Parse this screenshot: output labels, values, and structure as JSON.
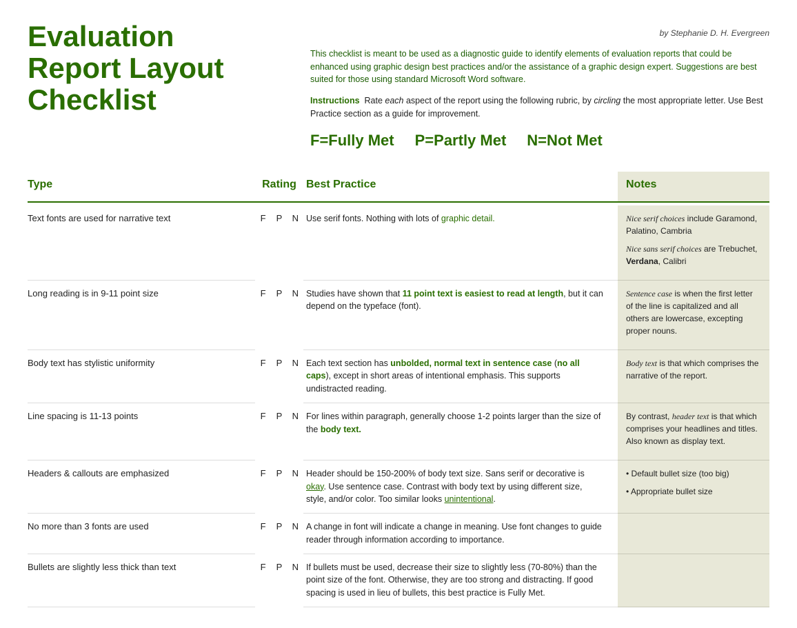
{
  "byline": "by Stephanie D. H. Evergreen",
  "title": {
    "line1": "Evaluation",
    "line2": "Report Layout",
    "line3": "Checklist"
  },
  "intro": "This checklist is meant to be used as a diagnostic guide to identify elements of evaluation reports that could be enhanced using graphic design best practices and/or the assistance of a graphic design expert. Suggestions are best suited for those using standard Microsoft Word software.",
  "instructions_label": "Instructions",
  "instructions_text": "Rate each aspect of the report using the following rubric, by circling the most appropriate letter. Use Best Practice section as a guide for improvement.",
  "legend": {
    "f": "F=Fully Met",
    "p": "P=Partly Met",
    "n": "N=Not Met"
  },
  "columns": {
    "type": "Type",
    "rating": "Rating",
    "practice": "Best Practice",
    "notes": "Notes"
  },
  "rows": [
    {
      "type": "Text fonts are used for narrative text",
      "practice": "Use serif fonts. Nothing with lots of graphic detail.",
      "practice_highlight": []
    },
    {
      "type": "Long reading is in 9-11 point size",
      "practice": "Studies have shown that 11 point text is easiest to read at length, but it can depend on the typeface (font).",
      "practice_highlight": [
        "11 point text is easiest to read at length"
      ]
    },
    {
      "type": "Body text has stylistic uniformity",
      "practice": "Each text section has unbolded, normal text in sentence case (no all caps), except in short areas of intentional emphasis. This supports undistracted reading.",
      "practice_highlight": [
        "unbolded, normal text in sentence case",
        "no all caps"
      ]
    },
    {
      "type": "Line spacing is 11-13 points",
      "practice": "For lines within paragraph, generally choose 1-2 points larger than the size of the body text.",
      "practice_highlight": [
        "body text"
      ]
    },
    {
      "type": "Headers & callouts are emphasized",
      "practice": "Header should be 150-200% of body text size. Sans serif or decorative is okay. Use sentence case. Contrast with body text by using different size, style, and/or color. Too similar looks unintentional.",
      "practice_highlight": [
        "okay",
        "unintentional"
      ]
    },
    {
      "type": "No more than 3 fonts are used",
      "practice": "A change in font will indicate a change in meaning. Use font changes to guide reader through information according to importance.",
      "practice_highlight": []
    },
    {
      "type": "Bullets are slightly less thick than text",
      "practice": "If bullets must be used, decrease their size to slightly less (70-80%) than the point size of the font. Otherwise, they are too strong and distracting. If good spacing is used in lieu of bullets, this best practice is Fully Met.",
      "practice_highlight": []
    }
  ],
  "notes": {
    "serif_italic": "Nice serif choices",
    "serif_rest": "include Garamond, Palatino, Cambria",
    "sans_italic": "Nice sans serif choices",
    "sans_rest": "are Trebuchet,",
    "sans_verdana": "Verdana",
    "sans_rest2": ", Calibri",
    "sentence_italic": "Sentence case",
    "sentence_rest": "is when the first letter of the line is capitalized and all others are lowercase, excepting proper nouns.",
    "body_italic": "Body text",
    "body_rest": "is that which comprises the narrative of the report.",
    "header_pre": "By contrast,",
    "header_italic": "header text",
    "header_rest": "is that which comprises your headlines and titles. Also known as display text.",
    "bullets": [
      "Default bullet size (too big)",
      "Appropriate bullet size"
    ]
  }
}
